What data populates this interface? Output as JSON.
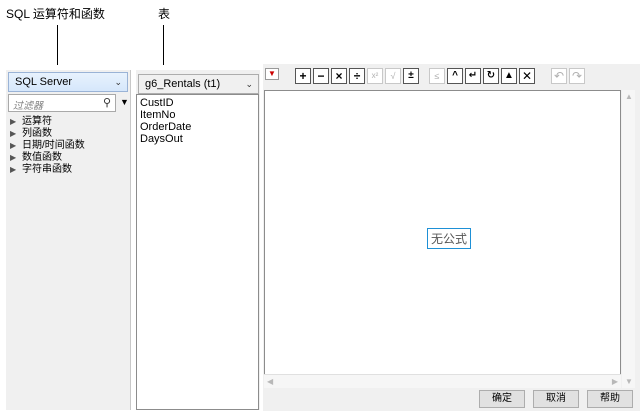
{
  "callouts": {
    "operators_and_functions": "SQL 运算符和函数",
    "table": "表"
  },
  "left": {
    "dialect": "SQL Server",
    "filter_placeholder": "过滤器",
    "tree": [
      "运算符",
      "列函数",
      "日期/时间函数",
      "数值函数",
      "字符串函数"
    ]
  },
  "columns": {
    "table_select": "g6_Rentals (t1)",
    "items": [
      "CustID",
      "ItemNo",
      "OrderDate",
      "DaysOut"
    ]
  },
  "editor": {
    "empty_text": "无公式"
  },
  "buttons": {
    "ok": "确定",
    "cancel": "取消",
    "help": "帮助"
  },
  "colors": {
    "accent": "#1e90d6",
    "dropdown_border": "#9ab3d6"
  }
}
